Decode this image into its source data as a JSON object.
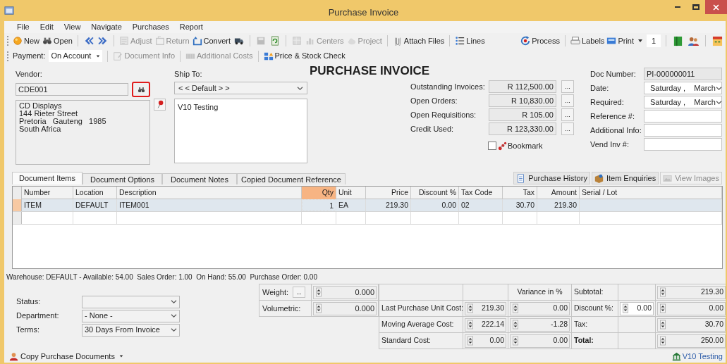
{
  "window": {
    "title": "Purchase Invoice"
  },
  "menu": [
    "File",
    "Edit",
    "View",
    "Navigate",
    "Purchases",
    "Report"
  ],
  "toolbar": [
    {
      "kind": "button",
      "label": "New",
      "disabled": false
    },
    {
      "kind": "button",
      "label": "Open",
      "disabled": false
    },
    {
      "kind": "icon",
      "disabled": false
    },
    {
      "kind": "icon",
      "disabled": false
    },
    {
      "kind": "button",
      "label": "Adjust",
      "disabled": true
    },
    {
      "kind": "button",
      "label": "Return",
      "disabled": true
    },
    {
      "kind": "button",
      "label": "Convert",
      "disabled": false
    },
    {
      "kind": "icon",
      "disabled": false
    },
    {
      "kind": "icon",
      "disabled": true
    },
    {
      "kind": "icon",
      "disabled": false
    },
    {
      "kind": "icon",
      "disabled": true
    },
    {
      "kind": "button",
      "label": "Centers",
      "disabled": true
    },
    {
      "kind": "button",
      "label": "Project",
      "disabled": true
    },
    {
      "kind": "button",
      "label": "Attach Files",
      "disabled": false
    },
    {
      "kind": "button",
      "label": "Lines",
      "disabled": false
    }
  ],
  "toolbar_right": [
    {
      "kind": "button",
      "label": "Process"
    },
    {
      "kind": "button",
      "label": "Labels"
    },
    {
      "kind": "button",
      "label": "Print"
    },
    {
      "kind": "dropdown"
    },
    {
      "kind": "input",
      "value": "1"
    },
    {
      "kind": "icon"
    },
    {
      "kind": "icon"
    },
    {
      "kind": "icon"
    }
  ],
  "payment": {
    "label": "Payment:",
    "value": "On Account"
  },
  "toolbar2": [
    {
      "label": "Document Info",
      "disabled": true
    },
    {
      "label": "Additional Costs",
      "disabled": true
    },
    {
      "label": "Price & Stock Check",
      "disabled": false
    }
  ],
  "vendor": {
    "label": "Vendor:",
    "code": "CDE001",
    "address": [
      "CD Displays",
      "144 Rieter Street",
      "Pretoria   Gauteng   1985",
      "South Africa"
    ]
  },
  "ship_to": {
    "label": "Ship To:",
    "option": "< < Default > >",
    "address": "V10 Testing"
  },
  "heading": "PURCHASE INVOICE",
  "balances": [
    {
      "label": "Outstanding Invoices:",
      "value": "R 112,500.00",
      "button": "..."
    },
    {
      "label": "Open Orders:",
      "value": "R 10,830.00",
      "button": "..."
    },
    {
      "label": "Open Requisitions:",
      "value": "R 105.00",
      "button": "..."
    },
    {
      "label": "Credit Used:",
      "value": "R 123,330.00",
      "button": "..."
    }
  ],
  "bookmark": {
    "label": "Bookmark",
    "checked": false
  },
  "doc_fields": [
    {
      "label": "Doc Number:",
      "kind": "readonly",
      "value": "PI-000000011"
    },
    {
      "label": "Date:",
      "kind": "date",
      "value": "Saturday ,    March"
    },
    {
      "label": "Required:",
      "kind": "date",
      "value": "Saturday ,    March"
    },
    {
      "label": "Reference #:",
      "kind": "text"
    },
    {
      "label": "Additional Info:",
      "kind": "text"
    },
    {
      "label": "Vend Inv #:",
      "kind": "text"
    }
  ],
  "tabs": [
    {
      "label": "Document Items",
      "selected": true
    },
    {
      "label": "Document Options",
      "selected": false
    },
    {
      "label": "Document Notes",
      "selected": false
    },
    {
      "label": "Copied Document Reference",
      "selected": false
    }
  ],
  "side_buttons": [
    {
      "label": "Purchase History",
      "disabled": false
    },
    {
      "label": "Item Enquiries",
      "disabled": false
    },
    {
      "label": "View Images",
      "disabled": true
    }
  ],
  "grid": {
    "columns": [
      {
        "label": "Number",
        "numeric": false,
        "selected": false
      },
      {
        "label": "Location",
        "numeric": false,
        "selected": false
      },
      {
        "label": "Description",
        "numeric": false,
        "selected": false
      },
      {
        "label": "Qty",
        "numeric": true,
        "selected": true
      },
      {
        "label": "Unit",
        "numeric": false,
        "selected": false
      },
      {
        "label": "Price",
        "numeric": true,
        "selected": false
      },
      {
        "label": "Discount %",
        "numeric": true,
        "selected": false
      },
      {
        "label": "Tax Code",
        "numeric": false,
        "selected": false
      },
      {
        "label": "Tax",
        "numeric": true,
        "selected": false
      },
      {
        "label": "Amount",
        "numeric": true,
        "selected": false
      },
      {
        "label": "Serial / Lot",
        "numeric": false,
        "selected": false
      }
    ],
    "rows": [
      {
        "selected": true,
        "cells": [
          "ITEM",
          "DEFAULT",
          "ITEM001",
          "1",
          "EA",
          "219.30",
          "0.00",
          "02",
          "30.70",
          "219.30"
        ]
      }
    ]
  },
  "stock_line": "Warehouse: DEFAULT - Available: 54.00  Sales Order: 1.00  On Hand: 55.00  Purchase Order: 0.00",
  "options": [
    {
      "label": "Status:"
    },
    {
      "label": "Department:",
      "value": "- None -"
    },
    {
      "label": "Terms:",
      "value": "30 Days From Invoice"
    }
  ],
  "measures": [
    {
      "label": "Weight:",
      "button": "...",
      "value": "0.000"
    },
    {
      "label": "Volumetric:",
      "value": "0.000"
    }
  ],
  "costs": {
    "header": "Variance in %",
    "rows": [
      {
        "label": "Last Purchase Unit Cost:",
        "cost": "219.30",
        "variance": "0.00"
      },
      {
        "label": "Moving Average Cost:",
        "cost": "222.14",
        "variance": "-1.28"
      },
      {
        "label": "Standard Cost:",
        "cost": "0.00",
        "variance": "0.00"
      }
    ]
  },
  "totals": [
    {
      "label": "Subtotal:",
      "value": "219.30",
      "emphasis": false
    },
    {
      "label": "Discount %:",
      "percent": "0.00",
      "value": "0.00",
      "emphasis": false
    },
    {
      "label": "Tax:",
      "value": "30.70",
      "emphasis": false
    },
    {
      "label": "Total:",
      "value": "250.00",
      "emphasis": true
    }
  ],
  "footer": {
    "copy": "Copy Purchase Documents",
    "company": "V10 Testing"
  }
}
